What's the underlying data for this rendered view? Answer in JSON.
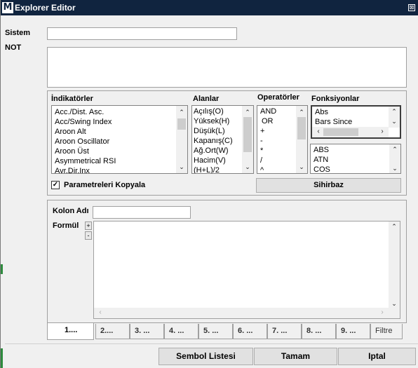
{
  "window": {
    "title": "Explorer Editor",
    "logo": "M",
    "close": "⊠"
  },
  "form": {
    "sistem_label": "Sistem",
    "not_label": "NOT",
    "sistem_value": "",
    "not_value": ""
  },
  "indicators": {
    "header": "İndikatörler",
    "items": [
      "Acc./Dist. Asc.",
      "Acc/Swing Index",
      "Aroon Alt",
      "Aroon Oscillator",
      "Aroon Üst",
      "Asymmetrical RSI",
      "Avr.Dir.Inx"
    ]
  },
  "fields": {
    "header": "Alanlar",
    "items": [
      "Açılış(O)",
      "Yüksek(H)",
      "Düşük(L)",
      "Kapanış(C)",
      "Ağ.Ort(W)",
      "Hacim(V)",
      "(H+L)/2"
    ]
  },
  "operators": {
    "header": "Operatörler",
    "items": [
      "AND",
      "OR",
      "+",
      "-",
      "*",
      "/",
      "^"
    ]
  },
  "functions": {
    "header": "Fonksiyonlar",
    "top_items": [
      "Abs",
      "Bars Since"
    ],
    "bottom_items": [
      "ABS",
      "ATN",
      "COS"
    ]
  },
  "options": {
    "copy_params_label": "Parametreleri Kopyala",
    "copy_params_checked": true,
    "wizard_label": "Sihirbaz"
  },
  "column": {
    "name_label": "Kolon Adı",
    "name_value": "",
    "formula_label": "Formül",
    "formula_value": "",
    "plus": "+",
    "minus": "-"
  },
  "tabs": [
    "1....",
    "2....",
    "3. ...",
    "4. ...",
    "5. ...",
    "6. ...",
    "7. ...",
    "8. ...",
    "9. ...",
    "Filtre"
  ],
  "actions": {
    "symbol_list": "Sembol Listesi",
    "ok": "Tamam",
    "cancel": "Iptal"
  },
  "colors": {
    "titlebar": "#10243f",
    "accent_green": "#2e8b3e"
  }
}
